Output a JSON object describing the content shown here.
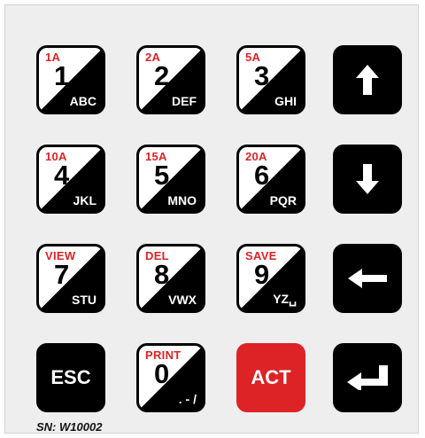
{
  "keypad": {
    "row1": [
      {
        "top": "1A",
        "num": "1",
        "letters": "ABC"
      },
      {
        "top": "2A",
        "num": "2",
        "letters": "DEF"
      },
      {
        "top": "5A",
        "num": "3",
        "letters": "GHI"
      }
    ],
    "row2": [
      {
        "top": "10A",
        "num": "4",
        "letters": "JKL"
      },
      {
        "top": "15A",
        "num": "5",
        "letters": "MNO"
      },
      {
        "top": "20A",
        "num": "6",
        "letters": "PQR"
      }
    ],
    "row3": [
      {
        "top": "VIEW",
        "num": "7",
        "letters": "STU"
      },
      {
        "top": "DEL",
        "num": "8",
        "letters": "VWX"
      },
      {
        "top": "SAVE",
        "num": "9",
        "letters": "YZ␣"
      }
    ],
    "row4": {
      "esc": "ESC",
      "zero": {
        "top": "PRINT",
        "num": "0",
        "letters": ". - /"
      },
      "act": "ACT"
    },
    "side_icons": [
      "up-arrow-icon",
      "down-arrow-icon",
      "backspace-arrow-icon",
      "enter-icon"
    ],
    "colors": {
      "accent_red": "#dd2326",
      "key_black": "#000000",
      "panel": "#eeeeee"
    }
  },
  "serial": "SN: W10002"
}
